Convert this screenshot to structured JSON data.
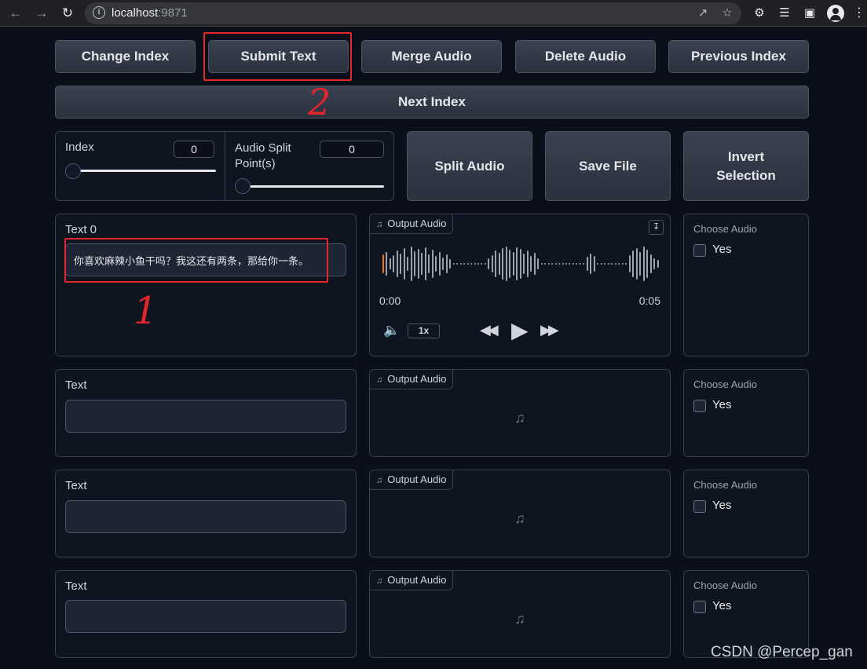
{
  "browser": {
    "url_host": "localhost",
    "url_port": ":9871",
    "icons": [
      "back-arrow-icon",
      "forward-arrow-icon",
      "reload-icon",
      "info-icon",
      "share-icon",
      "star-icon",
      "puzzle-icon",
      "media-list-icon",
      "sidebar-icon",
      "profile-icon",
      "kebab-icon"
    ]
  },
  "toolbar": {
    "change_index": "Change Index",
    "submit_text": "Submit Text",
    "merge_audio": "Merge Audio",
    "delete_audio": "Delete Audio",
    "previous_index": "Previous Index",
    "next_index": "Next Index"
  },
  "controls": {
    "index_label": "Index",
    "index_value": "0",
    "split_label_line1": "Audio Split",
    "split_label_line2": "Point(s)",
    "split_value": "0",
    "split_audio": "Split Audio",
    "save_file": "Save File",
    "invert_line1": "Invert",
    "invert_line2": "Selection"
  },
  "rows": [
    {
      "text_label": "Text 0",
      "text_value": "你喜欢麻辣小鱼干吗？我这还有两条，那给你一条。",
      "audio_label": "Output Audio",
      "choose_label": "Choose Audio",
      "yes_label": "Yes"
    },
    {
      "text_label": "Text",
      "text_value": "",
      "audio_label": "Output Audio",
      "choose_label": "Choose Audio",
      "yes_label": "Yes"
    },
    {
      "text_label": "Text",
      "text_value": "",
      "audio_label": "Output Audio",
      "choose_label": "Choose Audio",
      "yes_label": "Yes"
    },
    {
      "text_label": "Text",
      "text_value": "",
      "audio_label": "Output Audio",
      "choose_label": "Choose Audio",
      "yes_label": "Yes"
    }
  ],
  "player": {
    "time_start": "0:00",
    "time_end": "0:05",
    "speed": "1x"
  },
  "annotations": {
    "mark_1": "1",
    "mark_2": "2",
    "accent": "#e3262b"
  },
  "watermark": "CSDN @Percep_gan"
}
